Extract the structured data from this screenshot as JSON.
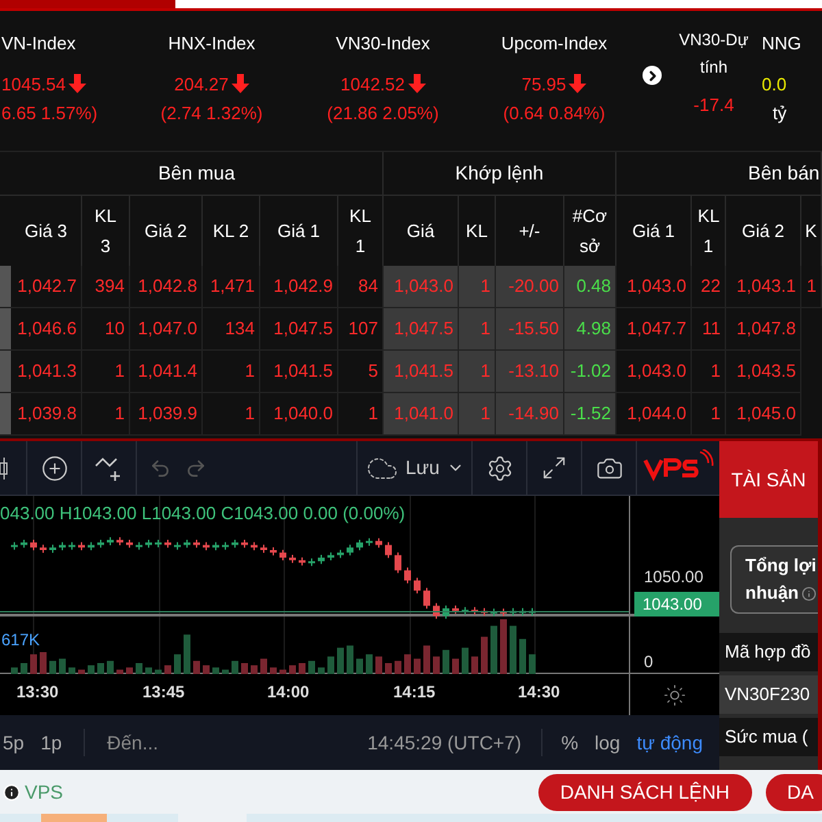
{
  "indices": [
    {
      "name": "VN-Index",
      "value": "1045.54",
      "change": "6.65 1.57%)"
    },
    {
      "name": "HNX-Index",
      "value": "204.27",
      "change": "(2.74 1.32%)"
    },
    {
      "name": "VN30-Index",
      "value": "1042.52",
      "change": "(21.86 2.05%)"
    },
    {
      "name": "Upcom-Index",
      "value": "75.95",
      "change": "(0.64 0.84%)"
    }
  ],
  "forecast": {
    "name": "VN30-Dự tính",
    "value": "-17.4"
  },
  "foreign": {
    "name": "NNG",
    "value": "0.0",
    "unit": "tỷ"
  },
  "order_book": {
    "groups": [
      {
        "label": "Bên mua",
        "kind": "buy"
      },
      {
        "label": "Khớp lệnh",
        "kind": "match"
      },
      {
        "label": "Bên bán",
        "kind": "sell"
      }
    ],
    "columns": [
      {
        "label": "Giá 3",
        "kind": "buy"
      },
      {
        "label": "KL 3",
        "kind": "buy"
      },
      {
        "label": "Giá 2",
        "kind": "buy"
      },
      {
        "label": "KL 2",
        "kind": "buy"
      },
      {
        "label": "Giá 1",
        "kind": "buy"
      },
      {
        "label": "KL 1",
        "kind": "buy"
      },
      {
        "label": "Giá",
        "kind": "match"
      },
      {
        "label": "KL",
        "kind": "match"
      },
      {
        "label": "+/-",
        "kind": "match"
      },
      {
        "label": "#Cơ sở",
        "kind": "basis"
      },
      {
        "label": "Giá 1",
        "kind": "sell"
      },
      {
        "label": "KL 1",
        "kind": "sell"
      },
      {
        "label": "Giá 2",
        "kind": "sell"
      },
      {
        "label": "K",
        "kind": "sell"
      }
    ],
    "rows": [
      {
        "cells": [
          "1,042.7",
          "394",
          "1,042.8",
          "1,471",
          "1,042.9",
          "84",
          "1,043.0",
          "1",
          "-20.00",
          "0.48",
          "1,043.0",
          "22",
          "1,043.1",
          "1"
        ]
      },
      {
        "cells": [
          "1,046.6",
          "10",
          "1,047.0",
          "134",
          "1,047.5",
          "107",
          "1,047.5",
          "1",
          "-15.50",
          "4.98",
          "1,047.7",
          "11",
          "1,047.8"
        ]
      },
      {
        "cells": [
          "1,041.3",
          "1",
          "1,041.4",
          "1",
          "1,041.5",
          "5",
          "1,041.5",
          "1",
          "-13.10",
          "-1.02",
          "1,043.0",
          "1",
          "1,043.5"
        ]
      },
      {
        "cells": [
          "1,039.8",
          "1",
          "1,039.9",
          "1",
          "1,040.0",
          "1",
          "1,041.0",
          "1",
          "-14.90",
          "-1.52",
          "1,044.0",
          "1",
          "1,045.0"
        ]
      }
    ]
  },
  "chart": {
    "save_label": "Lưu",
    "legend": "043.00 H1043.00 L1043.00 C1043.00 0.00 (0.00%)",
    "price_label": "1050.00",
    "last_price": "1043.00",
    "volume_label": "617K",
    "volume_axis": "0",
    "time_labels": [
      "13:30",
      "13:45",
      "14:00",
      "14:15",
      "14:30"
    ],
    "intervals": [
      "5p",
      "1p"
    ],
    "goto": "Đến...",
    "clock": "14:45:29 (UTC+7)",
    "options": [
      {
        "label": "%",
        "selected": false
      },
      {
        "label": "log",
        "selected": false
      },
      {
        "label": "tự động",
        "selected": true
      }
    ]
  },
  "side_panel": {
    "tab": {
      "label": "TÀI SẢN",
      "selected": true
    },
    "profit_label": "Tổng lợi nhuận",
    "rows": [
      {
        "text": "Mã hợp đồ",
        "kind": "header"
      },
      {
        "text": "VN30F230",
        "kind": "value"
      },
      {
        "text": "Sức mua (",
        "kind": "header"
      }
    ]
  },
  "footer": {
    "brand": "VPS",
    "buttons": [
      "DANH SÁCH LỆNH",
      "DA"
    ]
  }
}
